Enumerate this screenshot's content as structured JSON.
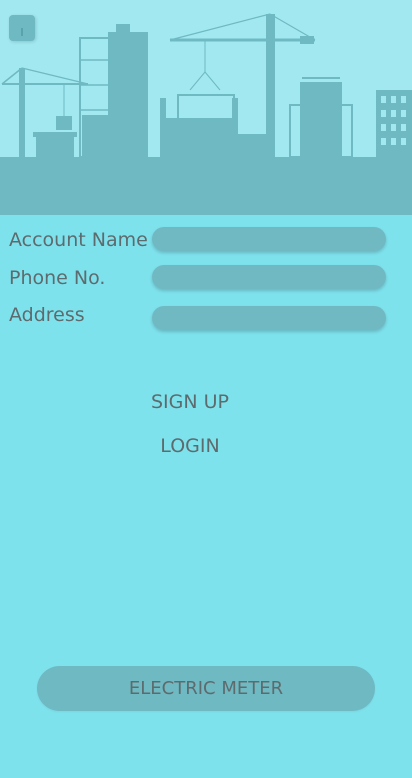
{
  "form": {
    "fields": [
      {
        "label": "Account Name",
        "value": "",
        "placeholder": ""
      },
      {
        "label": "Phone No.",
        "value": "",
        "placeholder": ""
      },
      {
        "label": "Address",
        "value": "",
        "placeholder": ""
      }
    ]
  },
  "actions": {
    "signup_label": "SIGN UP",
    "login_label": "LOGIN",
    "meter_label": "ELECTRIC METER"
  },
  "colors": {
    "background": "#7ee2ed",
    "header_sky": "#a2e8f1",
    "silhouette": "#6fb9c2",
    "text": "#5d6b6e"
  },
  "icons": {
    "menu": "menu-icon",
    "header_art": "construction-skyline-illustration"
  }
}
